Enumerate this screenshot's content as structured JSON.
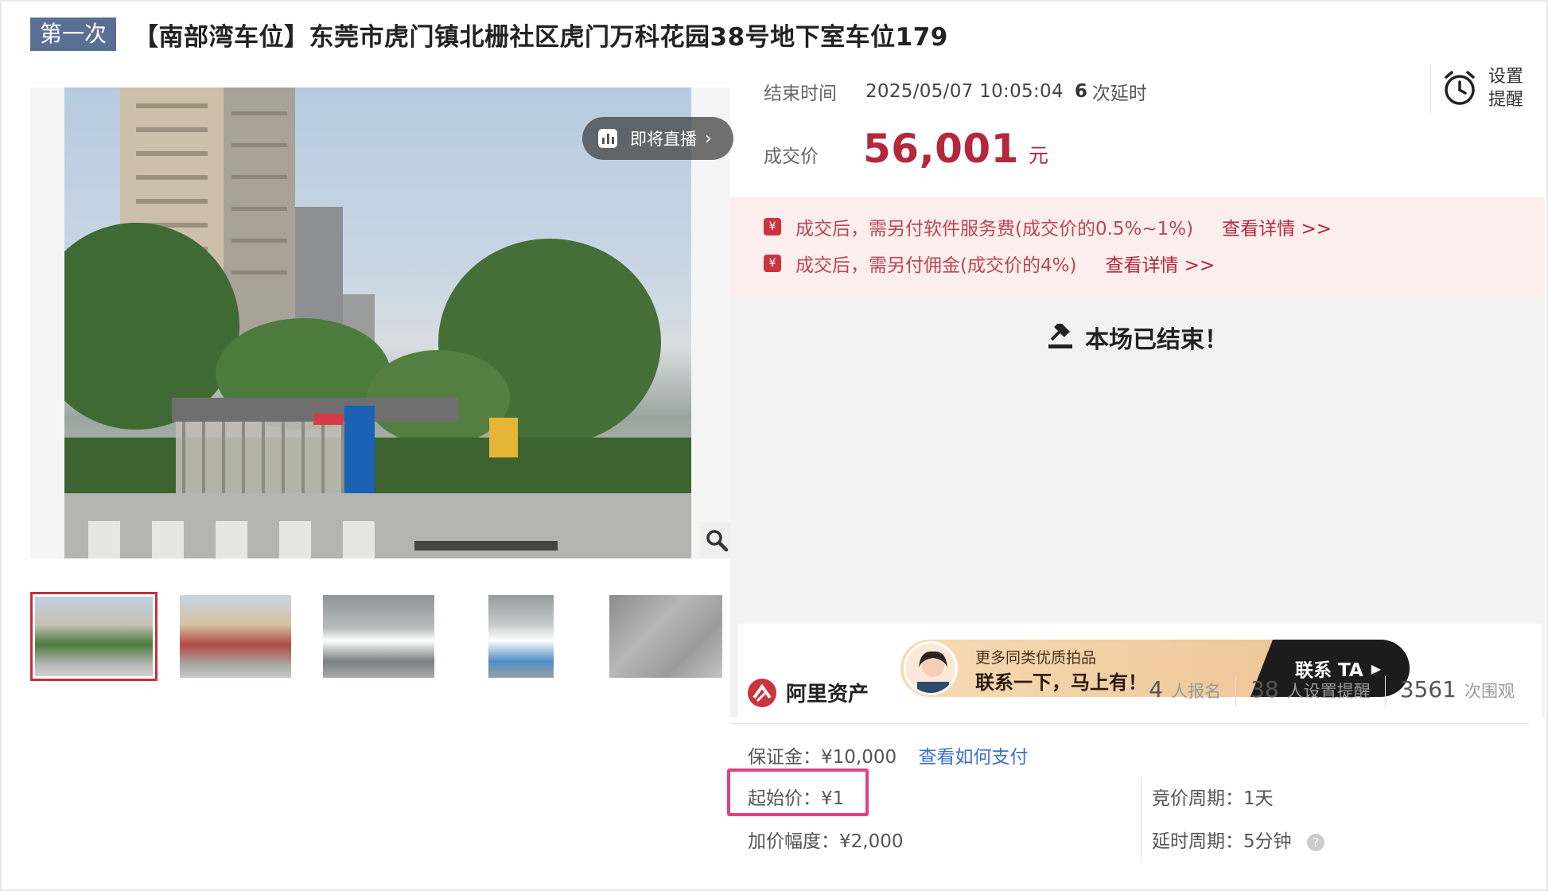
{
  "header": {
    "round_badge": "第一次",
    "title": "【南部湾车位】东莞市虎门镇北栅社区虎门万科花园38号地下室车位179"
  },
  "gallery": {
    "live_label": "即将直播",
    "live_chevron": "›",
    "zoom_icon": "magnifier-icon",
    "thumbnail_count": 5,
    "selected_thumbnail": 1
  },
  "auction": {
    "end_label": "结束时间",
    "end_time": "2025/05/07 10:05:04",
    "extension_count": "6",
    "extension_label": "次延时",
    "reminder_label": "设置提醒",
    "price_label": "成交价",
    "price_value": "56,001",
    "price_unit": "元"
  },
  "notices": [
    {
      "text": "成交后，需另付软件服务费(成交价的0.5%~1%)",
      "link": "查看详情 >>"
    },
    {
      "text": "成交后，需另付佣金(成交价的4%)",
      "link": "查看详情 >>"
    }
  ],
  "status": {
    "ended_message": "本场已结束！"
  },
  "promo": {
    "line1": "更多同类优质拍品",
    "line2": "联系一下，马上有！",
    "cta": "联系 TA"
  },
  "brand": {
    "name": "阿里资产"
  },
  "stats": [
    {
      "num": "4",
      "label": "人报名"
    },
    {
      "num": "38",
      "label": "人设置提醒"
    },
    {
      "num": "3561",
      "label": "次围观"
    }
  ],
  "details": {
    "deposit": "保证金：¥10,000",
    "deposit_link": "查看如何支付",
    "start_price": "起始价：¥1",
    "increment": "加价幅度：¥2,000",
    "bid_period": "竞价周期：1天",
    "delay_period": "延时周期：5分钟",
    "help_mark": "?"
  },
  "colors": {
    "accent_red": "#b3283a",
    "badge_blue": "#5a6f93",
    "notice_bg": "#fdeeee",
    "link_blue": "#3a72c8",
    "highlight_pink": "#e0417f"
  }
}
